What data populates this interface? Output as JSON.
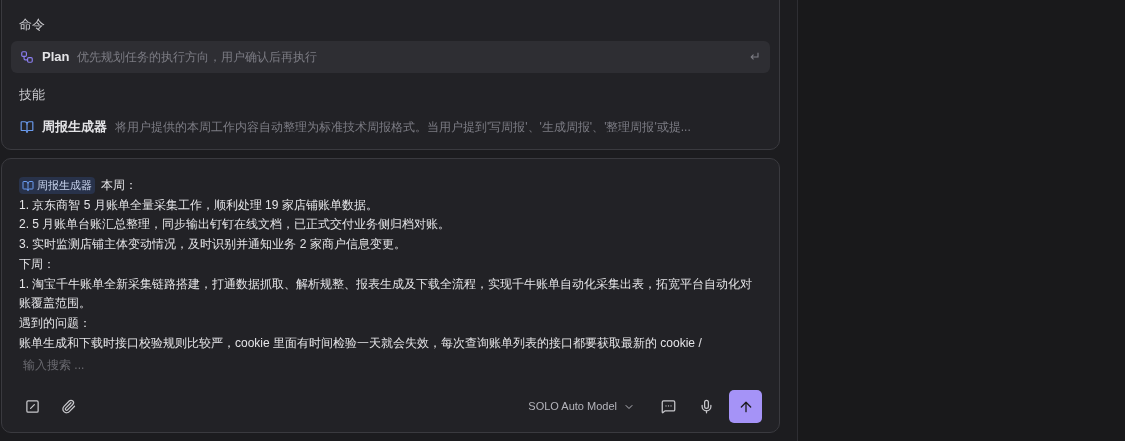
{
  "suggestions": {
    "sections": [
      {
        "heading": "命令",
        "items": [
          {
            "kind": "command",
            "name": "Plan",
            "description": "优先规划任务的执行方向，用户确认后再执行",
            "selected": true,
            "shortcut": "↵"
          }
        ]
      },
      {
        "heading": "技能",
        "items": [
          {
            "kind": "skill",
            "name": "周报生成器",
            "description": "将用户提供的本周工作内容自动整理为标准技术周报格式。当用户提到'写周报'、'生成周报'、'整理周报'或提...",
            "selected": false
          }
        ]
      }
    ]
  },
  "composer": {
    "skill_tag": "周报生成器",
    "lines": [
      "本周：",
      "1. 京东商智 5 月账单全量采集工作，顺利处理 19 家店铺账单数据。",
      "2. 5 月账单台账汇总整理，同步输出钉钉在线文档，已正式交付业务侧归档对账。",
      "3. 实时监测店铺主体变动情况，及时识别并通知业务 2 家商户信息变更。",
      "下周：",
      "1. 淘宝千牛账单全新采集链路搭建，打通数据抓取、解析规整、报表生成及下载全流程，实现千牛账单自动化采集出表，拓宽平台自动化对账覆盖范围。",
      "遇到的问题：",
      "账单生成和下载时接口校验规则比较严，cookie 里面有时间检验一天就会失效，每次查询账单列表的接口都要获取最新的 cookie /"
    ],
    "placeholder": "输入搜索 ...",
    "model": "SOLO Auto Model"
  }
}
